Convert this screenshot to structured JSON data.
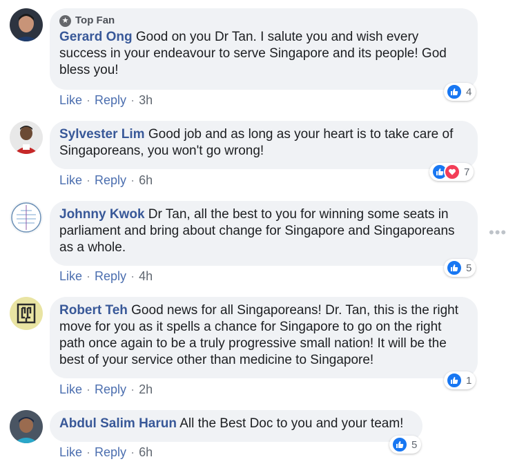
{
  "comments": [
    {
      "badge": "Top Fan",
      "author": "Gerard Ong",
      "text": "Good on you Dr Tan. I salute you and wish every success in your endeavour to serve Singapore and its people! God bless you!",
      "like": "Like",
      "reply": "Reply",
      "time": "3h",
      "reactions": [
        "like"
      ],
      "reaction_count": "4"
    },
    {
      "author": "Sylvester Lim",
      "text": "Good job and as long as your heart is to take care of Singaporeans, you won't go wrong!",
      "like": "Like",
      "reply": "Reply",
      "time": "6h",
      "reactions": [
        "like",
        "love"
      ],
      "reaction_count": "7"
    },
    {
      "author": "Johnny Kwok",
      "text": "Dr Tan, all the best to you for winning some seats in parliament and bring about change for Singapore and Singaporeans as a whole.",
      "like": "Like",
      "reply": "Reply",
      "time": "4h",
      "reactions": [
        "like"
      ],
      "reaction_count": "5"
    },
    {
      "author": "Robert Teh",
      "text": "Good news for all Singaporeans! Dr. Tan, this is the right move for you as it spells a chance for Singapore to go on the right path once again to be a truly progressive small nation! It will be the best of your service other than medicine to Singapore!",
      "like": "Like",
      "reply": "Reply",
      "time": "2h",
      "reactions": [
        "like"
      ],
      "reaction_count": "1"
    },
    {
      "author": "Abdul Salim Harun",
      "text": "All the Best Doc to you and your team!",
      "like": "Like",
      "reply": "Reply",
      "time": "6h",
      "reactions": [
        "like"
      ],
      "reaction_count": "5"
    }
  ],
  "icons": {
    "more": "more-options-icon",
    "badge": "star-badge-icon",
    "like": "thumbs-up-icon",
    "love": "heart-icon"
  },
  "colors": {
    "author": "#385898",
    "bubble": "#f0f2f5",
    "like_blue": "#1877f2",
    "love_red": "#f33e58",
    "action_link": "#4b6eaf"
  }
}
